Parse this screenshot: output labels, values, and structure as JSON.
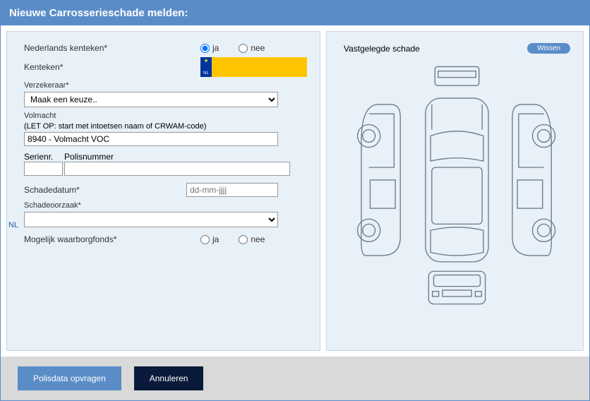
{
  "title": "Nieuwe Carrosserieschade melden:",
  "left": {
    "nl_kenteken_label": "Nederlands kenteken*",
    "ja": "ja",
    "nee": "nee",
    "kenteken_label": "Kenteken*",
    "plate_country": "NL",
    "verzekeraar_label": "Verzekeraar*",
    "verzekeraar_value": "Maak een keuze..",
    "volmacht_label": "Volmacht",
    "volmacht_hint": "(LET OP: start met intoetsen naam of CRWAM-code)",
    "volmacht_value": "8940 - Volmacht VOC",
    "serienr_label": "Serienr.",
    "polisnr_label": "Polisnummer",
    "nl_inline": "NL",
    "schadedatum_label": "Schadedatum*",
    "schadedatum_placeholder": "dd-mm-jjjj",
    "schadeoorzaak_label": "Schadeoorzaak*",
    "waarborg_label": "Mogelijk waarborgfonds*"
  },
  "right": {
    "title": "Vastgelegde schade",
    "wissen": "Wissen"
  },
  "footer": {
    "polis": "Polisdata opvragen",
    "annuleren": "Annuleren"
  }
}
